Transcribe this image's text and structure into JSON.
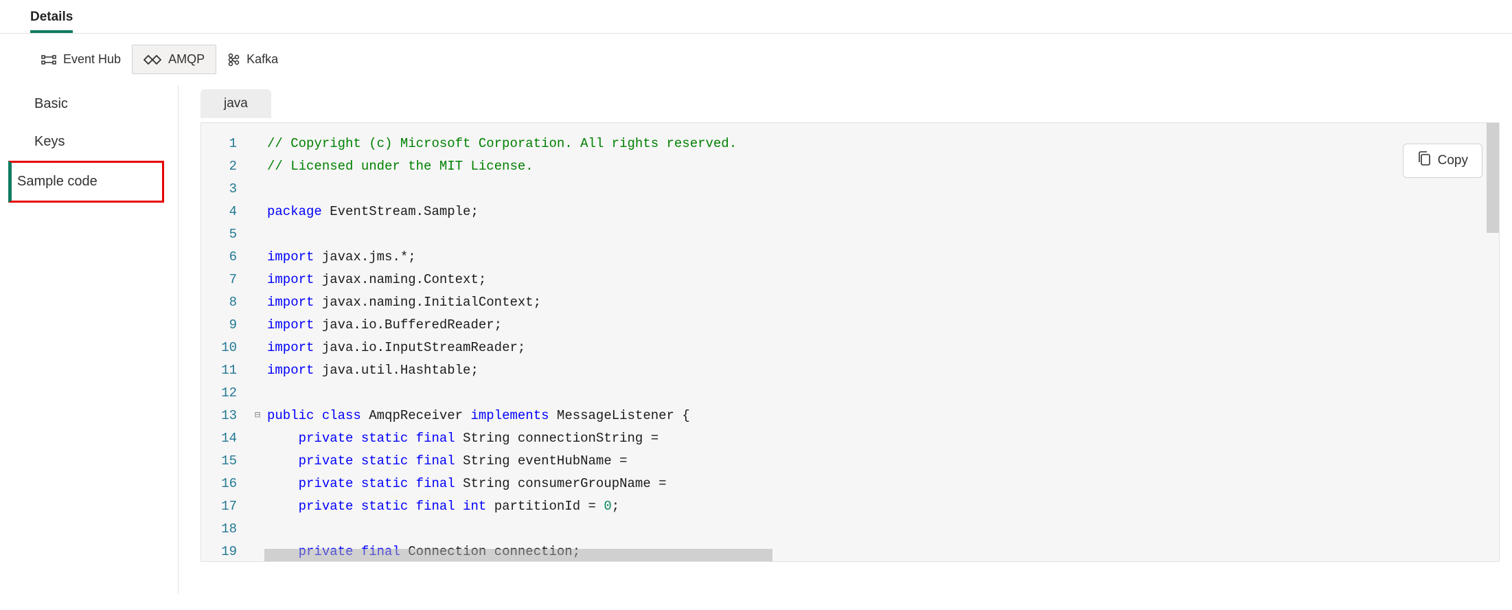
{
  "header": {
    "title": "Details"
  },
  "protocol_tabs": [
    {
      "id": "eventhub",
      "label": "Event Hub",
      "icon": "eventhub-icon",
      "active": false,
      "highlighted": false
    },
    {
      "id": "amqp",
      "label": "AMQP",
      "icon": "amqp-icon",
      "active": true,
      "highlighted": true
    },
    {
      "id": "kafka",
      "label": "Kafka",
      "icon": "kafka-icon",
      "active": false,
      "highlighted": false
    }
  ],
  "sidebar": {
    "items": [
      {
        "id": "basic",
        "label": "Basic",
        "selected": false,
        "highlighted": false
      },
      {
        "id": "keys",
        "label": "Keys",
        "selected": false,
        "highlighted": false
      },
      {
        "id": "sample",
        "label": "Sample code",
        "selected": true,
        "highlighted": true
      }
    ]
  },
  "editor": {
    "language_tab": "java",
    "copy_label": "Copy",
    "lines": [
      {
        "n": 1,
        "fold": "",
        "tokens": [
          {
            "t": "// Copyright (c) Microsoft Corporation. All rights reserved.",
            "c": "comment"
          }
        ]
      },
      {
        "n": 2,
        "fold": "",
        "tokens": [
          {
            "t": "// Licensed under the MIT License.",
            "c": "comment"
          }
        ]
      },
      {
        "n": 3,
        "fold": "",
        "tokens": []
      },
      {
        "n": 4,
        "fold": "",
        "tokens": [
          {
            "t": "package",
            "c": "keyword"
          },
          {
            "t": " EventStream.Sample;",
            "c": "default"
          }
        ]
      },
      {
        "n": 5,
        "fold": "",
        "tokens": []
      },
      {
        "n": 6,
        "fold": "",
        "tokens": [
          {
            "t": "import",
            "c": "keyword"
          },
          {
            "t": " javax.jms.*;",
            "c": "default"
          }
        ]
      },
      {
        "n": 7,
        "fold": "",
        "tokens": [
          {
            "t": "import",
            "c": "keyword"
          },
          {
            "t": " javax.naming.Context;",
            "c": "default"
          }
        ]
      },
      {
        "n": 8,
        "fold": "",
        "tokens": [
          {
            "t": "import",
            "c": "keyword"
          },
          {
            "t": " javax.naming.InitialContext;",
            "c": "default"
          }
        ]
      },
      {
        "n": 9,
        "fold": "",
        "tokens": [
          {
            "t": "import",
            "c": "keyword"
          },
          {
            "t": " java.io.BufferedReader;",
            "c": "default"
          }
        ]
      },
      {
        "n": 10,
        "fold": "",
        "tokens": [
          {
            "t": "import",
            "c": "keyword"
          },
          {
            "t": " java.io.InputStreamReader;",
            "c": "default"
          }
        ]
      },
      {
        "n": 11,
        "fold": "",
        "tokens": [
          {
            "t": "import",
            "c": "keyword"
          },
          {
            "t": " java.util.Hashtable;",
            "c": "default"
          }
        ]
      },
      {
        "n": 12,
        "fold": "",
        "tokens": []
      },
      {
        "n": 13,
        "fold": "⊟",
        "tokens": [
          {
            "t": "public",
            "c": "keyword"
          },
          {
            "t": " ",
            "c": "default"
          },
          {
            "t": "class",
            "c": "keyword"
          },
          {
            "t": " AmqpReceiver ",
            "c": "default"
          },
          {
            "t": "implements",
            "c": "keyword"
          },
          {
            "t": " MessageListener {",
            "c": "default"
          }
        ]
      },
      {
        "n": 14,
        "fold": "",
        "tokens": [
          {
            "t": "    ",
            "c": "default"
          },
          {
            "t": "private",
            "c": "keyword"
          },
          {
            "t": " ",
            "c": "default"
          },
          {
            "t": "static",
            "c": "keyword"
          },
          {
            "t": " ",
            "c": "default"
          },
          {
            "t": "final",
            "c": "keyword"
          },
          {
            "t": " String connectionString =",
            "c": "default"
          }
        ]
      },
      {
        "n": 15,
        "fold": "",
        "tokens": [
          {
            "t": "    ",
            "c": "default"
          },
          {
            "t": "private",
            "c": "keyword"
          },
          {
            "t": " ",
            "c": "default"
          },
          {
            "t": "static",
            "c": "keyword"
          },
          {
            "t": " ",
            "c": "default"
          },
          {
            "t": "final",
            "c": "keyword"
          },
          {
            "t": " String eventHubName =",
            "c": "default"
          }
        ]
      },
      {
        "n": 16,
        "fold": "",
        "tokens": [
          {
            "t": "    ",
            "c": "default"
          },
          {
            "t": "private",
            "c": "keyword"
          },
          {
            "t": " ",
            "c": "default"
          },
          {
            "t": "static",
            "c": "keyword"
          },
          {
            "t": " ",
            "c": "default"
          },
          {
            "t": "final",
            "c": "keyword"
          },
          {
            "t": " String consumerGroupName =",
            "c": "default"
          }
        ]
      },
      {
        "n": 17,
        "fold": "",
        "tokens": [
          {
            "t": "    ",
            "c": "default"
          },
          {
            "t": "private",
            "c": "keyword"
          },
          {
            "t": " ",
            "c": "default"
          },
          {
            "t": "static",
            "c": "keyword"
          },
          {
            "t": " ",
            "c": "default"
          },
          {
            "t": "final",
            "c": "keyword"
          },
          {
            "t": " ",
            "c": "default"
          },
          {
            "t": "int",
            "c": "keyword"
          },
          {
            "t": " partitionId = ",
            "c": "default"
          },
          {
            "t": "0",
            "c": "number"
          },
          {
            "t": ";",
            "c": "default"
          }
        ]
      },
      {
        "n": 18,
        "fold": "",
        "tokens": []
      },
      {
        "n": 19,
        "fold": "",
        "tokens": [
          {
            "t": "    ",
            "c": "default"
          },
          {
            "t": "private",
            "c": "keyword"
          },
          {
            "t": " ",
            "c": "default"
          },
          {
            "t": "final",
            "c": "keyword"
          },
          {
            "t": " Connection connection;",
            "c": "default"
          }
        ]
      }
    ]
  }
}
